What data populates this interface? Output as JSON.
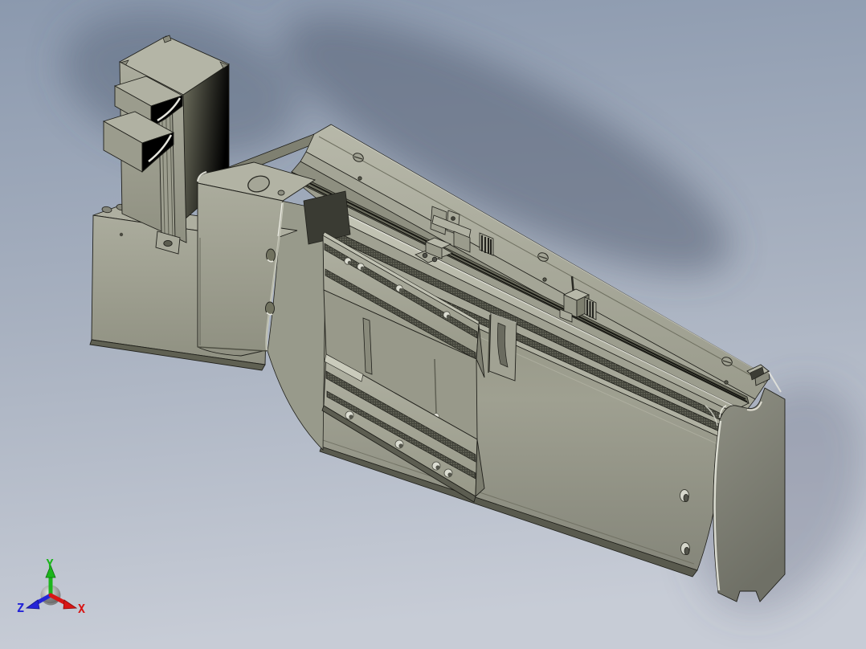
{
  "scene": {
    "background_top": "#8b99ae",
    "background_mid": "#a8b1c0",
    "background_bottom": "#c7ccd6",
    "shadow_color": "#4e5a6e",
    "model_color": "#9a9b8c",
    "model_color_light": "#b5b6a7",
    "model_color_dark": "#75766a",
    "knurl_color": "#43443b",
    "edge_color": "#20201b",
    "highlight_color": "#efefe6"
  },
  "triad": {
    "axes": [
      {
        "label": "X",
        "color": "#d81515"
      },
      {
        "label": "Y",
        "color": "#1cb51c"
      },
      {
        "label": "Z",
        "color": "#2525d8"
      }
    ]
  }
}
